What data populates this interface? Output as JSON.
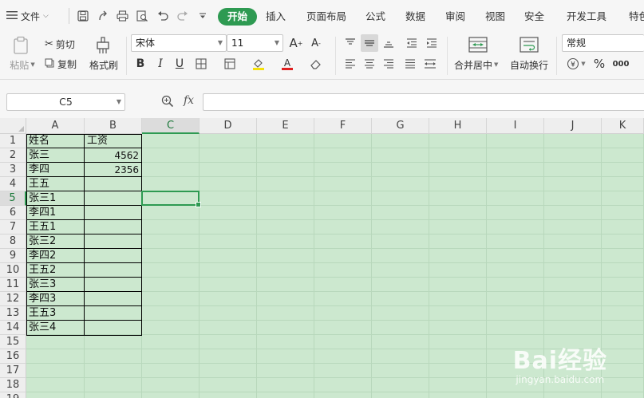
{
  "menu": {
    "file_label": "文件",
    "tabs": [
      "开始",
      "插入",
      "页面布局",
      "公式",
      "数据",
      "审阅",
      "视图",
      "安全",
      "开发工具",
      "特色"
    ],
    "active_tab": "开始"
  },
  "ribbon": {
    "paste": "粘贴",
    "cut": "剪切",
    "copy": "复制",
    "format_painter": "格式刷",
    "font_name": "宋体",
    "font_size": "11",
    "merge_center": "合并居中",
    "wrap_text": "自动换行",
    "number_format": "常规"
  },
  "formula_bar": {
    "name_box": "C5",
    "fx_label": "fx",
    "formula": ""
  },
  "sheet": {
    "columns": [
      "A",
      "B",
      "C",
      "D",
      "E",
      "F",
      "G",
      "H",
      "I",
      "J",
      "K"
    ],
    "rows": [
      "1",
      "2",
      "3",
      "4",
      "5",
      "6",
      "7",
      "8",
      "9",
      "10",
      "11",
      "12",
      "13",
      "14",
      "15",
      "16",
      "17",
      "18",
      "19"
    ],
    "active_cell": "C5",
    "cells": [
      {
        "ref": "A1",
        "value": "姓名"
      },
      {
        "ref": "B1",
        "value": "工资"
      },
      {
        "ref": "A2",
        "value": "张三"
      },
      {
        "ref": "B2",
        "value": "4562"
      },
      {
        "ref": "A3",
        "value": "李四"
      },
      {
        "ref": "B3",
        "value": "2356"
      },
      {
        "ref": "A4",
        "value": "王五"
      },
      {
        "ref": "A5",
        "value": "张三1"
      },
      {
        "ref": "A6",
        "value": "李四1"
      },
      {
        "ref": "A7",
        "value": "王五1"
      },
      {
        "ref": "A8",
        "value": "张三2"
      },
      {
        "ref": "A9",
        "value": "李四2"
      },
      {
        "ref": "A10",
        "value": "王五2"
      },
      {
        "ref": "A11",
        "value": "张三3"
      },
      {
        "ref": "A12",
        "value": "李四3"
      },
      {
        "ref": "A13",
        "value": "王五3"
      },
      {
        "ref": "A14",
        "value": "张三4"
      }
    ]
  },
  "watermark": {
    "brand": "Bai经验",
    "url": "jingyan.baidu.com"
  },
  "colors": {
    "accent": "#2e9a52",
    "sheet_bg": "#cce8cf"
  }
}
